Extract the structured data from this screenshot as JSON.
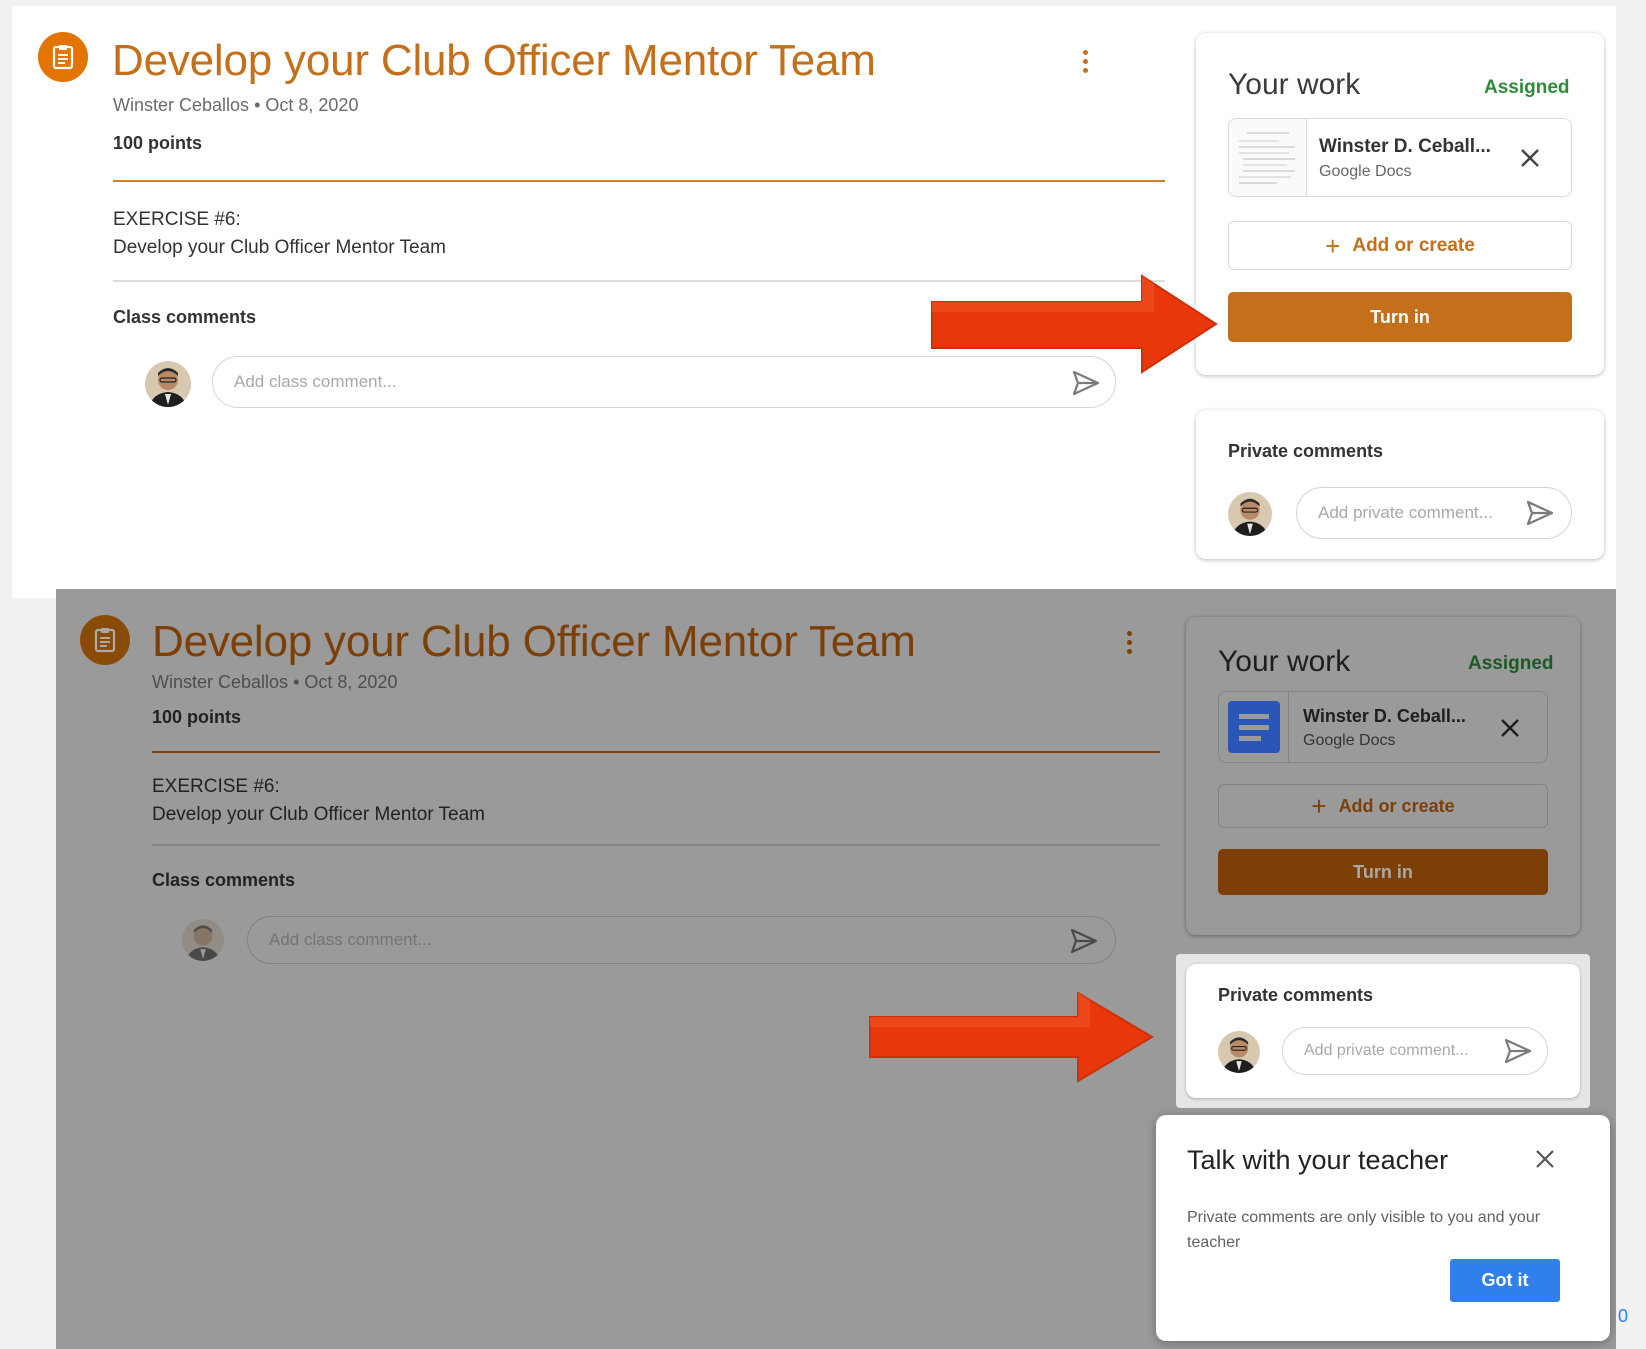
{
  "assignment": {
    "title": "Develop your Club Officer Mentor Team",
    "author": "Winster Ceballos",
    "separator": "•",
    "date": "Oct 8, 2020",
    "points": "100 points",
    "description_line1": "EXERCISE #6:",
    "description_line2": "Develop your Club Officer Mentor Team"
  },
  "class_comments": {
    "label": "Class comments",
    "placeholder": "Add class comment..."
  },
  "your_work": {
    "title": "Your work",
    "status": "Assigned",
    "attachment_name": "Winster D. Ceball...",
    "attachment_type": "Google Docs",
    "add_label": "Add or create",
    "turn_in_label": "Turn in"
  },
  "private_comments": {
    "label": "Private comments",
    "placeholder": "Add private comment..."
  },
  "tooltip": {
    "title": "Talk with your teacher",
    "body": "Private comments are only visible to you and your teacher",
    "button": "Got it"
  },
  "footer": {
    "edge_text": "0"
  },
  "colors": {
    "accent": "#c46f1a",
    "accent_dim": "#7c3f06",
    "assigned": "#2e8b3a",
    "arrow": "#e8370a",
    "tip_button": "#2f80ed"
  },
  "icons": [
    "assignment-icon",
    "more-vert-icon",
    "send-icon",
    "close-icon",
    "plus-icon",
    "google-docs-icon",
    "arrow-icon"
  ]
}
